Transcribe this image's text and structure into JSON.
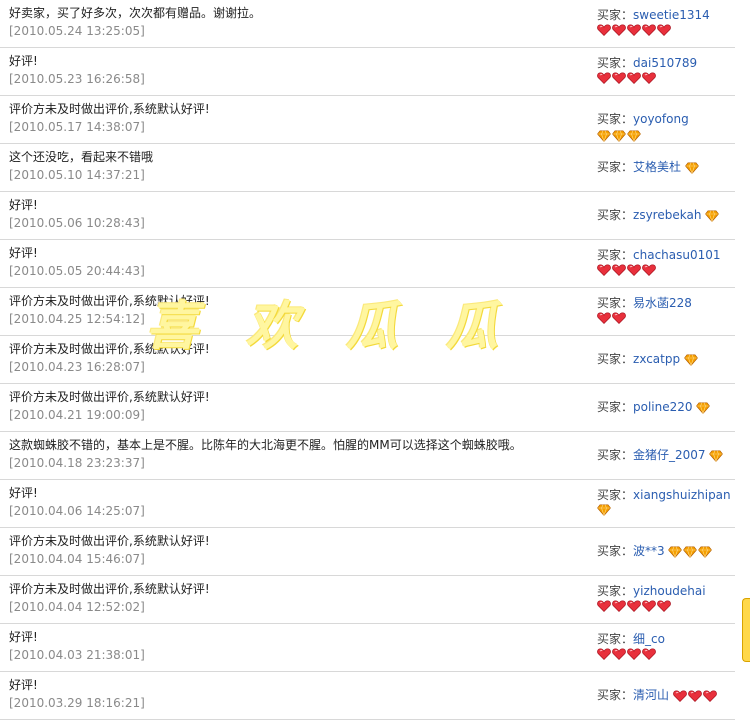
{
  "buyer_label": "买家：",
  "watermark": "喜欢瓜瓜",
  "colors": {
    "heart": "#e8303c",
    "diamond": "#f5a000",
    "link": "#2a5db0"
  },
  "reviews": [
    {
      "comment": "好卖家，买了好多次，次次都有赠品。谢谢拉。",
      "date": "[2010.05.24 13:25:05]",
      "buyer": "sweetie1314",
      "badge_type": "heart",
      "badge_count": 5
    },
    {
      "comment": "好评!",
      "date": "[2010.05.23 16:26:58]",
      "buyer": "dai510789",
      "badge_type": "heart",
      "badge_count": 4
    },
    {
      "comment": "评价方未及时做出评价,系统默认好评!",
      "date": "[2010.05.17 14:38:07]",
      "buyer": "yoyofong",
      "badge_type": "diamond",
      "badge_count": 3
    },
    {
      "comment": "这个还没吃，看起来不错哦",
      "date": "[2010.05.10 14:37:21]",
      "buyer": "艾格美杜",
      "badge_type": "diamond",
      "badge_count": 1
    },
    {
      "comment": "好评!",
      "date": "[2010.05.06 10:28:43]",
      "buyer": "zsyrebekah",
      "badge_type": "diamond",
      "badge_count": 1
    },
    {
      "comment": "好评!",
      "date": "[2010.05.05 20:44:43]",
      "buyer": "chachasu0101",
      "badge_type": "heart",
      "badge_count": 4
    },
    {
      "comment": "评价方未及时做出评价,系统默认好评!",
      "date": "[2010.04.25 12:54:12]",
      "buyer": "易水菡228",
      "badge_type": "heart",
      "badge_count": 2
    },
    {
      "comment": "评价方未及时做出评价,系统默认好评!",
      "date": "[2010.04.23 16:28:07]",
      "buyer": "zxcatpp",
      "badge_type": "diamond",
      "badge_count": 1
    },
    {
      "comment": "评价方未及时做出评价,系统默认好评!",
      "date": "[2010.04.21 19:00:09]",
      "buyer": "poline220",
      "badge_type": "diamond",
      "badge_count": 1
    },
    {
      "comment": "这款蜘蛛胶不错的，基本上是不腥。比陈年的大北海更不腥。怕腥的MM可以选择这个蜘蛛胶哦。",
      "date": "[2010.04.18 23:23:37]",
      "buyer": "金猪仔_2007",
      "badge_type": "diamond",
      "badge_count": 1
    },
    {
      "comment": "好评!",
      "date": "[2010.04.06 14:25:07]",
      "buyer": "xiangshuizhipan",
      "badge_type": "diamond",
      "badge_count": 1
    },
    {
      "comment": "评价方未及时做出评价,系统默认好评!",
      "date": "[2010.04.04 15:46:07]",
      "buyer": "波**3",
      "badge_type": "diamond",
      "badge_count": 3
    },
    {
      "comment": "评价方未及时做出评价,系统默认好评!",
      "date": "[2010.04.04 12:52:02]",
      "buyer": "yizhoudehai",
      "badge_type": "heart",
      "badge_count": 5
    },
    {
      "comment": "好评!",
      "date": "[2010.04.03 21:38:01]",
      "buyer": "细_co",
      "badge_type": "heart",
      "badge_count": 4
    },
    {
      "comment": "好评!",
      "date": "[2010.03.29 18:16:21]",
      "buyer": "清河山",
      "badge_type": "heart",
      "badge_count": 3
    }
  ]
}
